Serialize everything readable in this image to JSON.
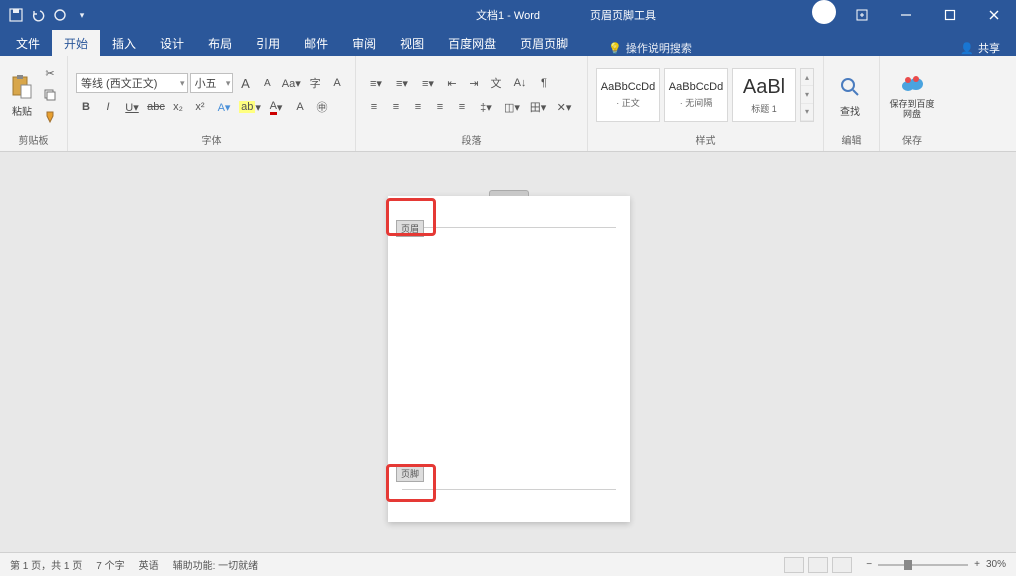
{
  "app": {
    "doc_title": "文档1 - Word",
    "tools_title": "页眉页脚工具"
  },
  "qat": {
    "save": "保存",
    "undo": "撤销",
    "redo": "恢复"
  },
  "window": {
    "min": "最小化",
    "max": "最大化",
    "close": "关闭"
  },
  "tabs": {
    "file": "文件",
    "home": "开始",
    "insert": "插入",
    "design": "设计",
    "layout": "布局",
    "references": "引用",
    "mailings": "邮件",
    "review": "审阅",
    "view": "视图",
    "baidu": "百度网盘",
    "hf_design": "页眉页脚",
    "tell_me": "操作说明搜索",
    "share": "共享"
  },
  "ribbon": {
    "clipboard": {
      "label": "剪贴板",
      "paste": "粘贴"
    },
    "font": {
      "label": "字体",
      "font_name": "等线 (西文正文)",
      "font_size": "小五",
      "grow": "A",
      "shrink": "A",
      "bold": "B",
      "italic": "I",
      "underline": "U"
    },
    "paragraph": {
      "label": "段落"
    },
    "styles": {
      "label": "样式",
      "item1_preview": "AaBbCcDd",
      "item1_name": "· 正文",
      "item2_preview": "AaBbCcDd",
      "item2_name": "· 无间隔",
      "item3_preview": "AaBl",
      "item3_name": "标题 1"
    },
    "editing": {
      "label": "编辑",
      "find": "查找"
    },
    "save": {
      "label": "保存",
      "baidu": "保存到百度网盘"
    }
  },
  "document": {
    "header_tag": "页眉",
    "footer_tag": "页脚"
  },
  "status": {
    "page": "第 1 页，共 1 页",
    "words": "7 个字",
    "lang": "英语",
    "accessibility": "辅助功能: 一切就绪",
    "zoom": "30%"
  }
}
